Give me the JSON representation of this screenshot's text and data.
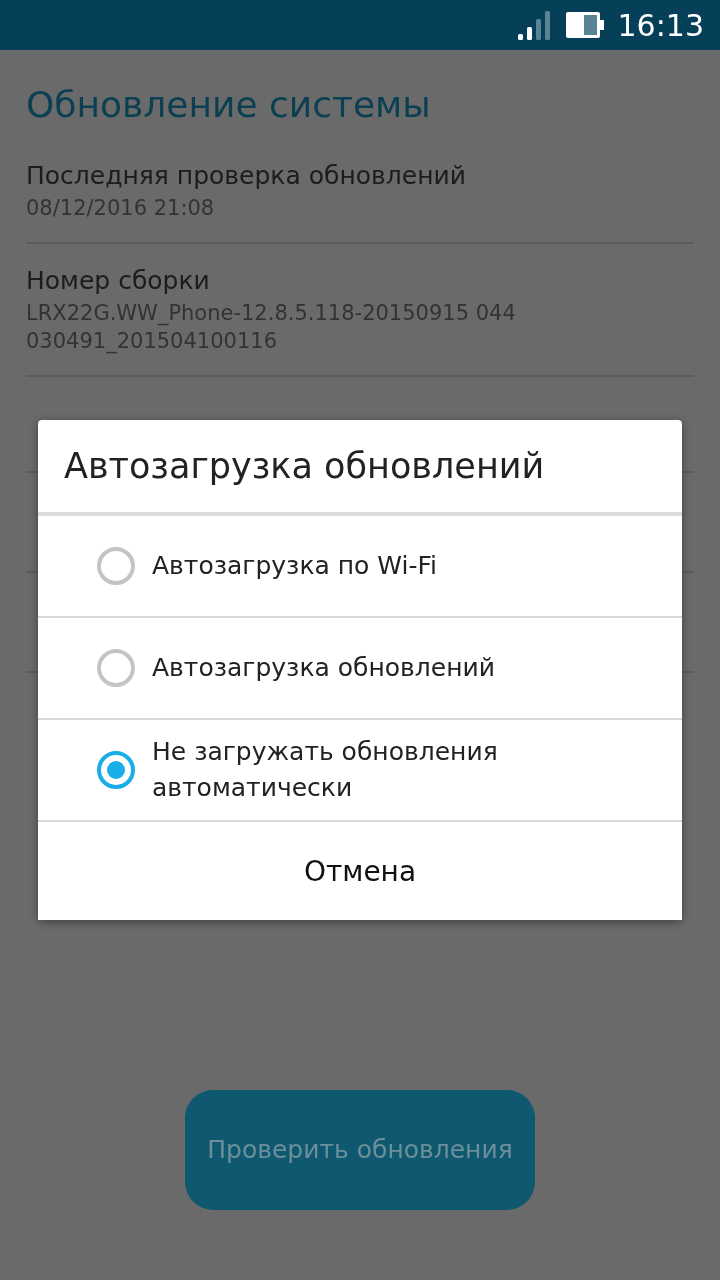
{
  "status_bar": {
    "time": "16:13"
  },
  "page": {
    "title": "Обновление системы",
    "items": [
      {
        "label": "Последняя проверка обновлений",
        "value": "08/12/2016 21:08"
      },
      {
        "label": "Номер сборки",
        "value": "LRX22G.WW_Phone-12.8.5.118-20150915 044030491_201504100116"
      }
    ],
    "button": "Проверить обновления"
  },
  "dialog": {
    "title": "Автозагрузка обновлений",
    "options": [
      {
        "label": "Автозагрузка по Wi-Fi",
        "selected": false
      },
      {
        "label": "Автозагрузка обновлений",
        "selected": false
      },
      {
        "label": "Не загружать обновления автоматически",
        "selected": true
      }
    ],
    "cancel": "Отмена"
  }
}
